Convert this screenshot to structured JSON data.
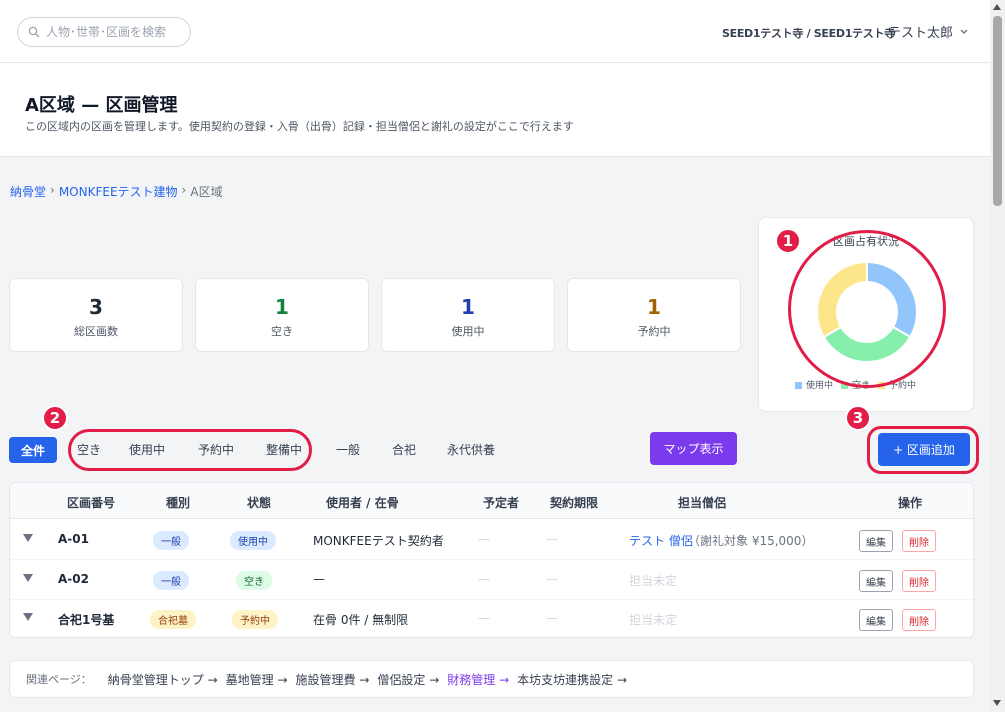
{
  "topbar": {
    "search_placeholder": "人物･世帯･区画を検索",
    "temple": "SEED1テスト寺 / SEED1テスト寺",
    "user": "テスト太郎"
  },
  "header": {
    "title": "A区域 — 区画管理",
    "subtitle": "この区域内の区画を管理します。使用契約の登録・入骨（出骨）記録・担当僧侶と謝礼の設定がここで行えます"
  },
  "breadcrumb": [
    {
      "label": "納骨堂"
    },
    {
      "label": "MONKFEEテスト建物"
    },
    {
      "label": "A区域"
    }
  ],
  "stats": [
    {
      "value": "3",
      "label": "総区画数",
      "color": "#1f2937"
    },
    {
      "value": "1",
      "label": "空き",
      "color": "#15803d"
    },
    {
      "value": "1",
      "label": "使用中",
      "color": "#1e40af"
    },
    {
      "value": "1",
      "label": "予約中",
      "color": "#a16207"
    }
  ],
  "chart_data": {
    "type": "pie",
    "title": "区画占有状況",
    "categories": [
      "使用中",
      "空き",
      "予約中"
    ],
    "values": [
      1,
      1,
      1
    ],
    "colors": [
      "#93c5fd",
      "#86efac",
      "#fde68a"
    ],
    "legend": "bottom"
  },
  "annotations": [
    "1",
    "2",
    "3"
  ],
  "filters": {
    "all": "全件",
    "items": [
      "空き",
      "使用中",
      "予約中",
      "整備中",
      "一般",
      "合祀",
      "永代供養"
    ]
  },
  "actions": {
    "map": "マップ表示",
    "add": "+ 区画追加"
  },
  "table": {
    "headers": [
      "区画番号",
      "種別",
      "状態",
      "使用者 / 在骨",
      "予定者",
      "契約期限",
      "担当僧侶",
      "操作"
    ],
    "rows": [
      {
        "id": "A-01",
        "type": "一般",
        "status": "使用中",
        "user": "MONKFEEテスト契約者",
        "planned": "—",
        "expiry": "—",
        "monk": "テスト 僧侶",
        "fee": "（謝礼対象 ¥15,000）"
      },
      {
        "id": "A-02",
        "type": "一般",
        "status": "空き",
        "user": "—",
        "planned": "—",
        "expiry": "—",
        "monk": "担当未定",
        "fee": ""
      },
      {
        "id": "合祀1号基",
        "type": "合祀墓",
        "status": "予約中",
        "user": "在骨 0件 / 無制限",
        "planned": "—",
        "expiry": "—",
        "monk": "担当未定",
        "fee": ""
      }
    ],
    "edit_label": "編集",
    "delete_label": "削除"
  },
  "related": {
    "label": "関連ページ：",
    "links": [
      "納骨堂管理トップ →",
      "墓地管理 →",
      "施設管理費 →",
      "僧侶設定 →",
      "財務管理 →",
      "本坊支坊連携設定 →"
    ]
  }
}
